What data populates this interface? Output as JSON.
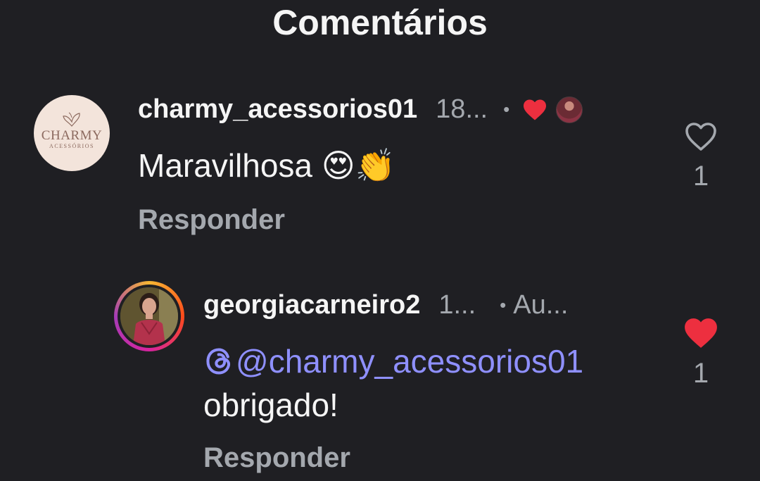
{
  "header": {
    "title": "Comentários"
  },
  "comment": {
    "avatar": {
      "brand_name": "CHARMY",
      "brand_sub": "ACESSÓRIOS"
    },
    "username": "charmy_acessorios01",
    "time": "18...",
    "separator": "•",
    "author_liked_icon": "heart-filled-icon",
    "text": "Maravilhosa 😍👏",
    "reply_label": "Responder",
    "like_icon": "heart-outline-icon",
    "like_count": "1"
  },
  "reply": {
    "username": "georgiacarneiro2",
    "time": "1...",
    "separator": "•",
    "tag": "Au...",
    "mention_icon": "threads-at-icon",
    "mention": "@charmy_acessorios01",
    "text": "obrigado!",
    "reply_label": "Responder",
    "like_icon": "heart-filled-icon",
    "like_count": "1"
  },
  "colors": {
    "background": "#1f1f23",
    "text": "#f5f5f5",
    "muted": "#a4a8ae",
    "mention": "#8f90ff",
    "heart": "#ed2f3f"
  }
}
